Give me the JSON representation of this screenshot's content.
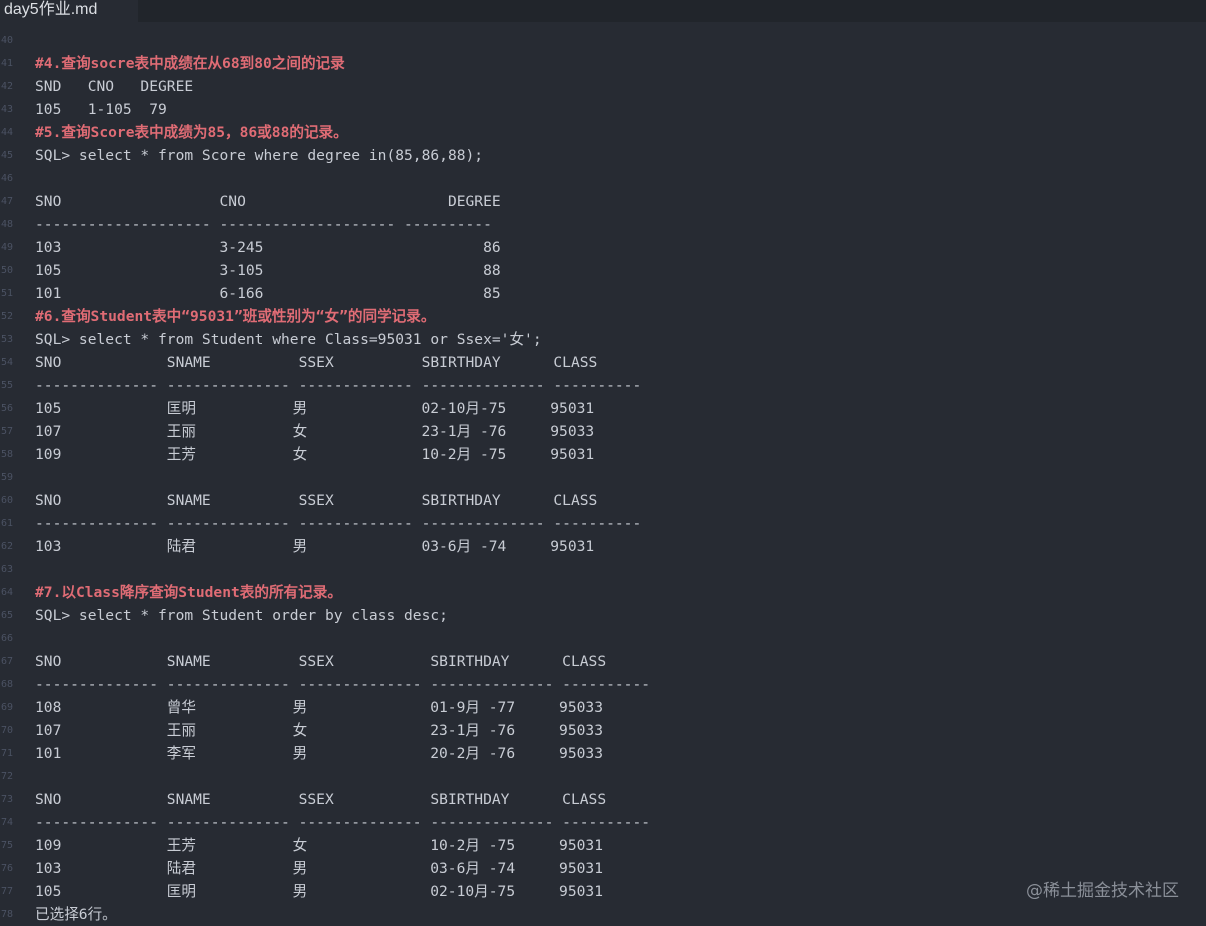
{
  "tab": {
    "title": "day5作业.md"
  },
  "lines": [
    {
      "n": "40",
      "t": "",
      "h": false
    },
    {
      "n": "41",
      "t": "#4.查询socre表中成绩在从68到80之间的记录",
      "h": true
    },
    {
      "n": "42",
      "t": "SND   CNO   DEGREE",
      "h": false
    },
    {
      "n": "43",
      "t": "105   1-105  79",
      "h": false
    },
    {
      "n": "44",
      "t": "#5.查询Score表中成绩为85，86或88的记录。",
      "h": true
    },
    {
      "n": "45",
      "t": "SQL> select * from Score where degree in(85,86,88);",
      "h": false
    },
    {
      "n": "46",
      "t": "",
      "h": false
    },
    {
      "n": "47",
      "t": "SNO                  CNO                       DEGREE",
      "h": false
    },
    {
      "n": "48",
      "t": "-------------------- -------------------- ----------",
      "h": false
    },
    {
      "n": "49",
      "t": "103                  3-245                         86",
      "h": false
    },
    {
      "n": "50",
      "t": "105                  3-105                         88",
      "h": false
    },
    {
      "n": "51",
      "t": "101                  6-166                         85",
      "h": false
    },
    {
      "n": "52",
      "t": "#6.查询Student表中“95031”班或性别为“女”的同学记录。",
      "h": true
    },
    {
      "n": "53",
      "t": "SQL> select * from Student where Class=95031 or Ssex='女';",
      "h": false
    },
    {
      "n": "54",
      "t": "SNO            SNAME          SSEX          SBIRTHDAY      CLASS",
      "h": false
    },
    {
      "n": "55",
      "t": "-------------- -------------- ------------- -------------- ----------",
      "h": false
    },
    {
      "n": "56",
      "t": "105            匡明           男             02-10月-75     95031",
      "h": false
    },
    {
      "n": "57",
      "t": "107            王丽           女             23-1月 -76     95033",
      "h": false
    },
    {
      "n": "58",
      "t": "109            王芳           女             10-2月 -75     95031",
      "h": false
    },
    {
      "n": "59",
      "t": "",
      "h": false
    },
    {
      "n": "60",
      "t": "SNO            SNAME          SSEX          SBIRTHDAY      CLASS",
      "h": false
    },
    {
      "n": "61",
      "t": "-------------- -------------- ------------- -------------- ----------",
      "h": false
    },
    {
      "n": "62",
      "t": "103            陆君           男             03-6月 -74     95031",
      "h": false
    },
    {
      "n": "63",
      "t": "",
      "h": false
    },
    {
      "n": "64",
      "t": "#7.以Class降序查询Student表的所有记录。",
      "h": true
    },
    {
      "n": "65",
      "t": "SQL> select * from Student order by class desc;",
      "h": false
    },
    {
      "n": "66",
      "t": "",
      "h": false
    },
    {
      "n": "67",
      "t": "SNO            SNAME          SSEX           SBIRTHDAY      CLASS",
      "h": false
    },
    {
      "n": "68",
      "t": "-------------- -------------- -------------- -------------- ----------",
      "h": false
    },
    {
      "n": "69",
      "t": "108            曾华           男              01-9月 -77     95033",
      "h": false
    },
    {
      "n": "70",
      "t": "107            王丽           女              23-1月 -76     95033",
      "h": false
    },
    {
      "n": "71",
      "t": "101            李军           男              20-2月 -76     95033",
      "h": false
    },
    {
      "n": "72",
      "t": "",
      "h": false
    },
    {
      "n": "73",
      "t": "SNO            SNAME          SSEX           SBIRTHDAY      CLASS",
      "h": false
    },
    {
      "n": "74",
      "t": "-------------- -------------- -------------- -------------- ----------",
      "h": false
    },
    {
      "n": "75",
      "t": "109            王芳           女              10-2月 -75     95031",
      "h": false
    },
    {
      "n": "76",
      "t": "103            陆君           男              03-6月 -74     95031",
      "h": false
    },
    {
      "n": "77",
      "t": "105            匡明           男              02-10月-75     95031",
      "h": false
    },
    {
      "n": "78",
      "t": "已选择6行。",
      "h": false
    }
  ],
  "watermark": "@稀土掘金技术社区",
  "colors": {
    "background": "#272b33",
    "tabbar": "#21252b",
    "heading": "#e06c75",
    "text": "#c8ccd4",
    "line_number": "#4b5263"
  }
}
